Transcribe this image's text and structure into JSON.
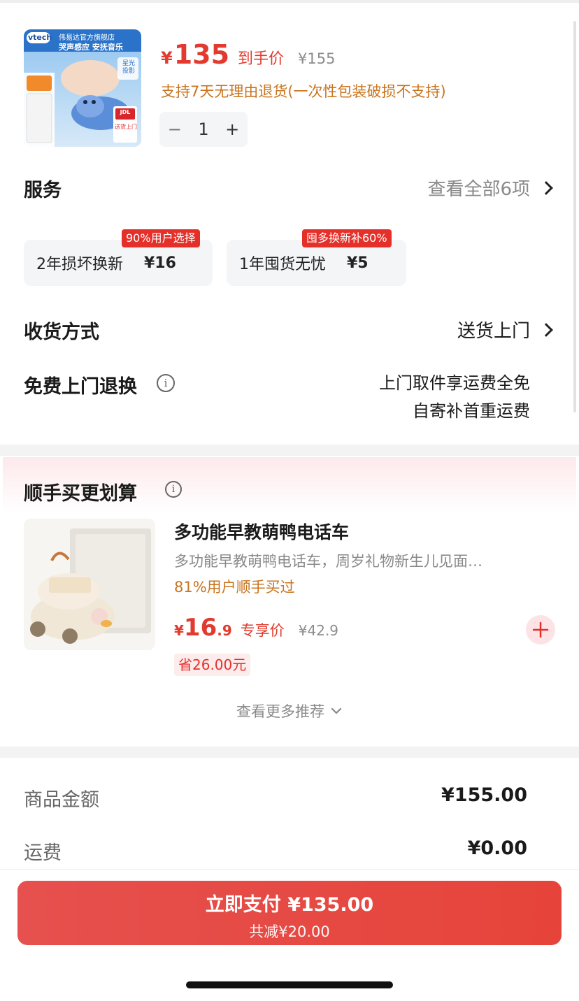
{
  "product": {
    "brand": "vtech",
    "store": "伟易达官方旗舰店",
    "slogan": "哭声感应 安抚音乐",
    "thumb_badge_top": "星光投影",
    "thumb_badge_jdl": "JDL",
    "thumb_badge_delivery": "送货上门",
    "price_currency": "¥",
    "price_value": "135",
    "price_tag": "到手价",
    "original_price": "¥155",
    "return_policy": "支持7天无理由退货(一次性包装破损不支持)",
    "quantity": "1",
    "minus_symbol": "−",
    "plus_symbol": "+"
  },
  "services": {
    "title": "服务",
    "view_all": "查看全部6项",
    "items": [
      {
        "name": "2年损坏换新",
        "price": "¥16",
        "badge": "90%用户选择"
      },
      {
        "name": "1年囤货无忧",
        "price": "¥5",
        "badge": "囤多换新补60%"
      }
    ]
  },
  "delivery": {
    "title": "收货方式",
    "value": "送货上门"
  },
  "free_return": {
    "title": "免费上门退换",
    "info_symbol": "i",
    "line1": "上门取件享运费全免",
    "line2": "自寄补首重运费"
  },
  "bundle": {
    "title": "顺手买更划算",
    "info_symbol": "i",
    "item": {
      "name": "多功能早教萌鸭电话车",
      "desc": "多功能早教萌鸭电话车，周岁礼物新生儿见面…",
      "social": "81%用户顺手买过",
      "price_currency": "¥",
      "price_int": "16",
      "price_dec": ".9",
      "price_tag": "专享价",
      "original_price": "¥42.9",
      "saving": "省26.00元"
    },
    "more": "查看更多推荐"
  },
  "summary": {
    "goods_label": "商品金额",
    "goods_value": "¥155.00",
    "shipping_label": "运费",
    "shipping_value": "¥0.00"
  },
  "pay": {
    "main": "立即支付 ¥135.00",
    "sub": "共减¥20.00"
  },
  "colors": {
    "accent_red": "#e5302a",
    "price_red": "#e23a2e",
    "policy_orange": "#c8741f"
  }
}
